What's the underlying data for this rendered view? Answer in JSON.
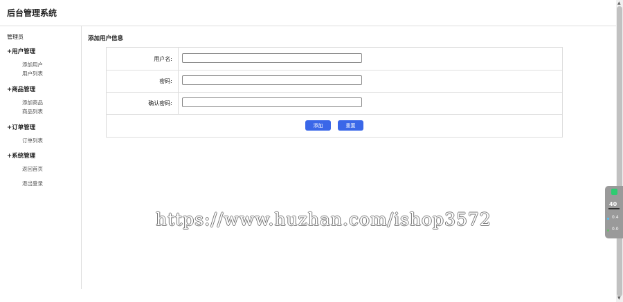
{
  "app": {
    "title": "后台管理系统"
  },
  "sidebar": {
    "role": "管理员",
    "groups": [
      {
        "title": "+用户管理",
        "items": [
          "添加用户",
          "用户列表"
        ]
      },
      {
        "title": "+商品管理",
        "items": [
          "添加商品",
          "商品列表"
        ]
      },
      {
        "title": "+订单管理",
        "items": [
          "订单列表"
        ]
      },
      {
        "title": "+系统管理",
        "items": [
          "返回首页",
          "退出登录"
        ]
      }
    ]
  },
  "main": {
    "section_title": "添加用户信息",
    "form": {
      "username_label": "用户名:",
      "username_value": "",
      "password_label": "密码:",
      "password_value": "",
      "confirm_label": "确认密码:",
      "confirm_value": "",
      "add_button": "添加",
      "reset_button": "重置"
    }
  },
  "watermark": "https://www.huzhan.com/ishop3572",
  "widget": {
    "value": "40",
    "up_rate": "0.4",
    "down_rate": "0.0"
  },
  "colors": {
    "accent": "#3a67e8",
    "border": "#dddddd",
    "widget_ok": "#2ecc71"
  }
}
